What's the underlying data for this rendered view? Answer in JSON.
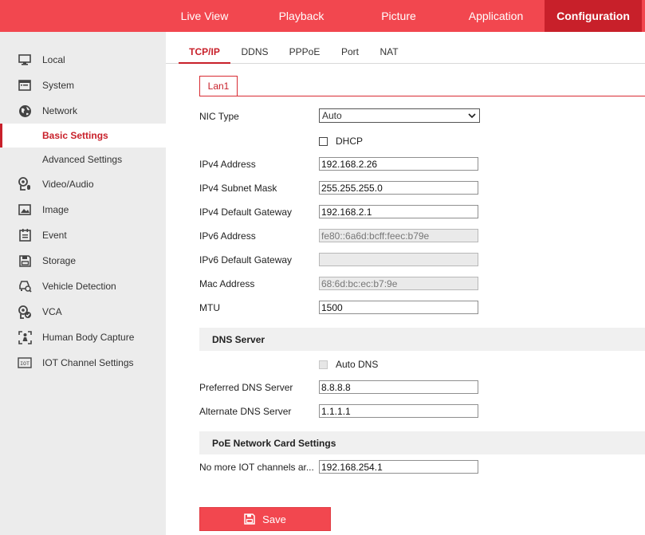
{
  "topnav": {
    "items": [
      {
        "label": "Live View"
      },
      {
        "label": "Playback"
      },
      {
        "label": "Picture"
      },
      {
        "label": "Application"
      },
      {
        "label": "Configuration",
        "active": true
      }
    ]
  },
  "sidebar": {
    "items": [
      {
        "label": "Local",
        "icon": "monitor-icon"
      },
      {
        "label": "System",
        "icon": "window-icon"
      },
      {
        "label": "Network",
        "icon": "globe-icon"
      },
      {
        "label": "Basic Settings",
        "active": true
      },
      {
        "label": "Advanced Settings"
      },
      {
        "label": "Video/Audio",
        "icon": "camera-mic-icon"
      },
      {
        "label": "Image",
        "icon": "image-icon"
      },
      {
        "label": "Event",
        "icon": "calendar-icon"
      },
      {
        "label": "Storage",
        "icon": "disk-icon"
      },
      {
        "label": "Vehicle Detection",
        "icon": "vehicle-search-icon"
      },
      {
        "label": "VCA",
        "icon": "vca-camera-icon"
      },
      {
        "label": "Human Body Capture",
        "icon": "body-capture-icon"
      },
      {
        "label": "IOT Channel Settings",
        "icon": "iot-icon"
      }
    ]
  },
  "tabs": [
    "TCP/IP",
    "DDNS",
    "PPPoE",
    "Port",
    "NAT"
  ],
  "lan_tab": "Lan1",
  "form": {
    "nic_type_label": "NIC Type",
    "nic_type_value": "Auto",
    "dhcp_label": "DHCP",
    "ipv4_address_label": "IPv4 Address",
    "ipv4_address": "192.168.2.26",
    "ipv4_mask_label": "IPv4 Subnet Mask",
    "ipv4_mask": "255.255.255.0",
    "ipv4_gateway_label": "IPv4 Default Gateway",
    "ipv4_gateway": "192.168.2.1",
    "ipv6_address_label": "IPv6 Address",
    "ipv6_address": "fe80::6a6d:bcff:feec:b79e",
    "ipv6_gateway_label": "IPv6 Default Gateway",
    "ipv6_gateway": "",
    "mac_label": "Mac Address",
    "mac": "68:6d:bc:ec:b7:9e",
    "mtu_label": "MTU",
    "mtu": "1500",
    "dns_section": "DNS Server",
    "auto_dns_label": "Auto DNS",
    "preferred_dns_label": "Preferred DNS Server",
    "preferred_dns": "8.8.8.8",
    "alternate_dns_label": "Alternate DNS Server",
    "alternate_dns": "1.1.1.1",
    "poe_section": "PoE Network Card Settings",
    "iot_label": "No more IOT channels ar...",
    "iot_value": "192.168.254.1"
  },
  "save_label": "Save",
  "colors": {
    "accent": "#f2474f",
    "accent_dark": "#c8202a",
    "sidebar_bg": "#ececec"
  }
}
